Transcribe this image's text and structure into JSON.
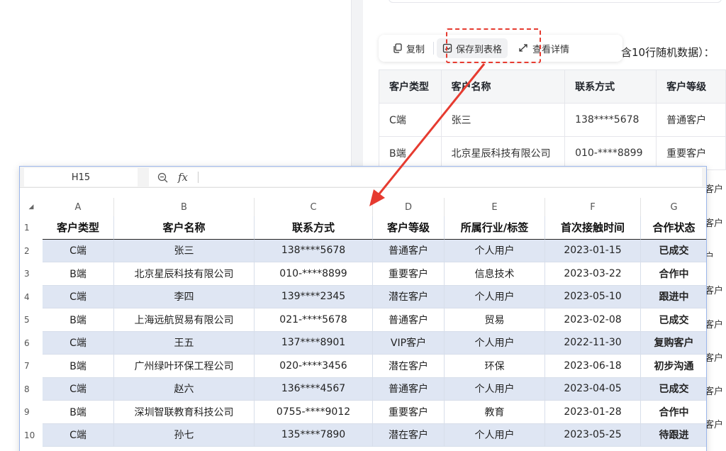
{
  "toolbar": {
    "copy_label": "复制",
    "save_label": "保存到表格",
    "detail_label": "查看详情"
  },
  "intro_text": "含10行随机数据）：",
  "preview_table": {
    "headers": [
      "客户类型",
      "客户名称",
      "联系方式",
      "客户等级"
    ],
    "rows": [
      [
        "C端",
        "张三",
        "138****5678",
        "普通客户"
      ],
      [
        "B端",
        "北京星辰科技有限公司",
        "010-****8899",
        "重要客户"
      ]
    ],
    "hidden_fragments": [
      "客户",
      "客户",
      "户",
      "客户",
      "客户",
      "客户",
      "客户",
      "客户"
    ]
  },
  "spreadsheet": {
    "cell_ref": "H15",
    "fx_label": "fx",
    "columns": [
      "A",
      "B",
      "C",
      "D",
      "E",
      "F",
      "G"
    ],
    "row_numbers": [
      "1",
      "2",
      "3",
      "4",
      "5",
      "6",
      "7",
      "8",
      "9",
      "10"
    ],
    "header": [
      "客户类型",
      "客户名称",
      "联系方式",
      "客户等级",
      "所属行业/标签",
      "首次接触时间",
      "合作状态"
    ],
    "rows": [
      [
        "C端",
        "张三",
        "138****5678",
        "普通客户",
        "个人用户",
        "2023-01-15",
        "已成交"
      ],
      [
        "B端",
        "北京星辰科技有限公司",
        "010-****8899",
        "重要客户",
        "信息技术",
        "2023-03-22",
        "合作中"
      ],
      [
        "C端",
        "李四",
        "139****2345",
        "潜在客户",
        "个人用户",
        "2023-05-10",
        "跟进中"
      ],
      [
        "B端",
        "上海远航贸易有限公司",
        "021-****5678",
        "普通客户",
        "贸易",
        "2023-02-08",
        "已成交"
      ],
      [
        "C端",
        "王五",
        "137****8901",
        "VIP客户",
        "个人用户",
        "2022-11-30",
        "复购客户"
      ],
      [
        "B端",
        "广州绿叶环保工程公司",
        "020-****3456",
        "潜在客户",
        "环保",
        "2023-06-18",
        "初步沟通"
      ],
      [
        "C端",
        "赵六",
        "136****4567",
        "普通客户",
        "个人用户",
        "2023-04-05",
        "已成交"
      ],
      [
        "B端",
        "深圳智联教育科技公司",
        "0755-****9012",
        "重要客户",
        "教育",
        "2023-01-28",
        "合作中"
      ],
      [
        "C端",
        "孙七",
        "135****7890",
        "潜在客户",
        "个人用户",
        "2023-05-25",
        "待跟进"
      ]
    ]
  },
  "colors": {
    "accent_red": "#e63b30",
    "row_stripe": "#dfe6f3",
    "sheet_border": "#9bb6ea"
  }
}
